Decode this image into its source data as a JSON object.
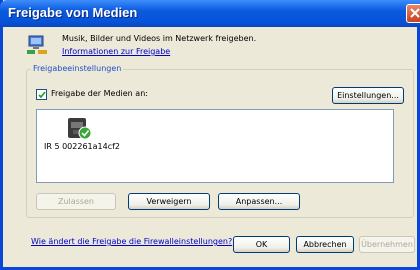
{
  "window": {
    "title": "Freigabe von Medien"
  },
  "info": {
    "icon": "network-share-icon",
    "description": "Musik, Bilder und Videos im Netzwerk freigeben.",
    "link": "Informationen zur Freigabe"
  },
  "settings_group": {
    "label": "Freigabeeinstellungen",
    "share_checkbox": {
      "label": "Freigabe der Medien an:",
      "checked": true
    },
    "settings_button": "Einstellungen...",
    "devices": [
      {
        "name": "IR 5 002261a14cf2",
        "icon": "media-device-icon",
        "status": "allowed"
      }
    ],
    "buttons": {
      "allow": "Zulassen",
      "deny": "Verweigern",
      "customize": "Anpassen..."
    }
  },
  "footer": {
    "firewall_link": "Wie ändert die Freigabe die Firewalleinstellungen?",
    "ok": "OK",
    "cancel": "Abbrechen",
    "apply": "Übernehmen"
  },
  "colors": {
    "titlebar": "#0553d8",
    "link": "#0000cc",
    "group_label": "#1f4ec7",
    "dialog_bg": "#ece9d8"
  }
}
